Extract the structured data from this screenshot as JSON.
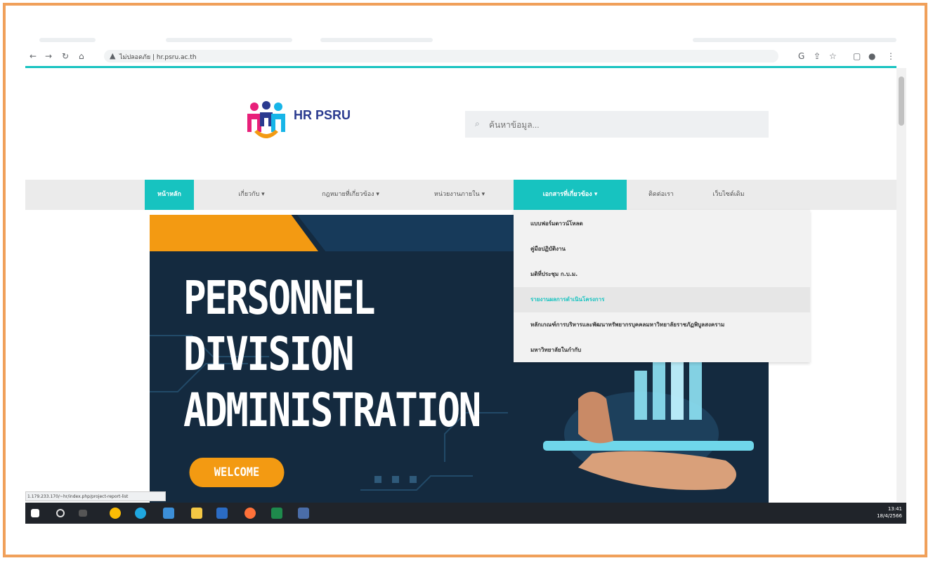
{
  "browser": {
    "url": "hr.psru.ac.th",
    "security_label": "ไม่ปลอดภัย"
  },
  "header": {
    "logo_text": "HR PSRU",
    "search_placeholder": "ค้นหาข้อมูล..."
  },
  "nav": {
    "items": [
      {
        "label": "หน้าหลัก",
        "state": "active"
      },
      {
        "label": "เกี่ยวกับ ▾",
        "state": "normal"
      },
      {
        "label": "กฎหมายที่เกี่ยวข้อง ▾",
        "state": "normal"
      },
      {
        "label": "หน่วยงานภายใน ▾",
        "state": "normal"
      },
      {
        "label": "เอกสารที่เกี่ยวข้อง ▾",
        "state": "open"
      },
      {
        "label": "ติดต่อเรา",
        "state": "normal"
      },
      {
        "label": "เว็บไซต์เดิม",
        "state": "normal"
      }
    ]
  },
  "dropdown": {
    "items": [
      {
        "label": "แบบฟอร์มดาวน์โหลด"
      },
      {
        "label": "คู่มือปฏิบัติงาน"
      },
      {
        "label": "มติที่ประชุม ก.บ.ม."
      },
      {
        "label": "รายงานผลการดำเนินโครงการ",
        "highlighted": true
      },
      {
        "label": "หลักเกณฑ์การบริหารและพัฒนาทรัพยากรบุคคลมหาวิทยาลัยราชภัฏพิบูลสงคราม"
      },
      {
        "label": "มหาวิทยาลัยในกำกับ"
      }
    ]
  },
  "banner": {
    "title_lines": [
      "PERSONNEL",
      "DIVISION",
      "ADMINISTRATION"
    ],
    "button_label": "WELCOME"
  },
  "status_bar": {
    "link_preview": "1.179.233.170/~hr/index.php/project-report-list"
  },
  "taskbar": {
    "time": "13:41",
    "date": "18/4/2566"
  },
  "colors": {
    "accent": "#17c3c0",
    "banner_bg": "#142a3f",
    "banner_orange": "#f39a12",
    "frame": "#f0a05a"
  }
}
